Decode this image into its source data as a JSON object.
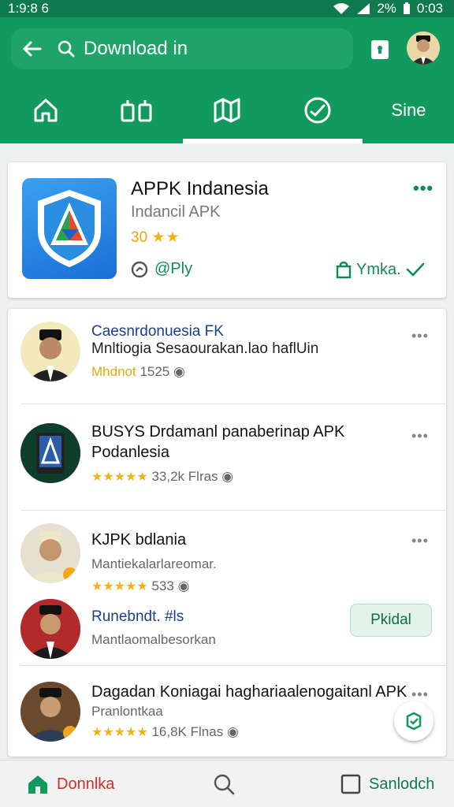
{
  "status_bar": {
    "time": "1:9:8 6",
    "battery": "2%",
    "clock": "0:03"
  },
  "header": {
    "search_text": "Download in",
    "tabs": [
      {
        "icon": "home-icon"
      },
      {
        "icon": "apps-icon"
      },
      {
        "icon": "map-icon"
      },
      {
        "icon": "compass-icon"
      },
      {
        "label": "Sine"
      }
    ]
  },
  "featured": {
    "title": "APPK Indanesia",
    "subtitle": "Indancil APK",
    "rating": "30",
    "stars": "★★",
    "play_label": "@Ply",
    "install_label": "Ymka."
  },
  "list": [
    {
      "title": "Caesnrdonuesia FK",
      "subtitle": "Mnltiogia Sesaourakan.lao haflUin",
      "meta_prefix": "Mhdnot",
      "meta_count": "1525"
    },
    {
      "title": "BUSYS Drdamanl panaberinap APK",
      "title2": "Podanlesia",
      "stars": "★★★★★",
      "meta_count": "33,2k",
      "meta_suffix": "Flras"
    },
    {
      "title": "KJPK bdlania",
      "subtitle": "Mantiekalarlareomar.",
      "stars": "★★★★★",
      "meta_count": "533"
    },
    {
      "title": "Runebndt. #ls",
      "subtitle": "Mantlaomalbesorkan",
      "button": "Pkidal"
    },
    {
      "title": "Dagadan Koniagai haghariaalenogaitanl APK",
      "subtitle": "Pranlontkaa",
      "stars": "★★★★★",
      "meta_count": "16,8K",
      "meta_suffix": "Flnas"
    }
  ],
  "bottom_nav": {
    "home_label": "Donnlka",
    "save_label": "Sanlodch"
  },
  "colors": {
    "brand": "#129a5e",
    "accent_red": "#d42a2a",
    "star": "#f2b318"
  }
}
